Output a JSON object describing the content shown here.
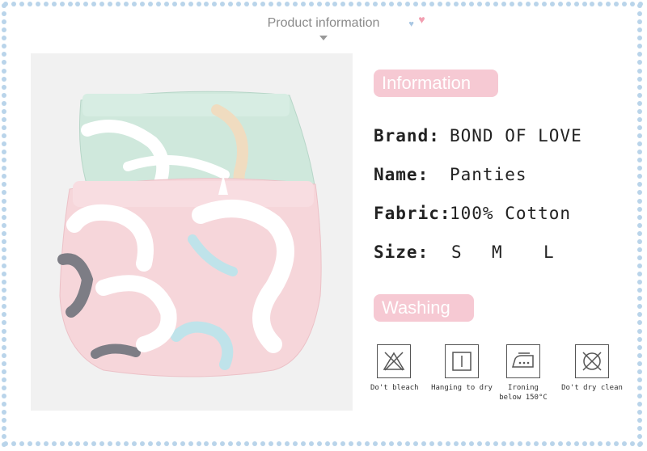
{
  "header": {
    "title": "Product information"
  },
  "info_section": {
    "heading": "Information",
    "brand_label": "Brand:",
    "brand_value": "BOND OF LOVE",
    "name_label": "Name:",
    "name_value": "Panties",
    "fabric_label": "Fabric:",
    "fabric_value": "100% Cotton",
    "size_label": "Size:",
    "sizes": [
      "S",
      "M",
      "L"
    ]
  },
  "washing_section": {
    "heading": "Washing",
    "items": [
      {
        "icon": "no-bleach-icon",
        "caption": "Do't bleach"
      },
      {
        "icon": "hang-dry-icon",
        "caption": "Hanging to dry"
      },
      {
        "icon": "iron-icon",
        "caption": "Ironing",
        "caption2": "below 150°C"
      },
      {
        "icon": "no-dry-clean-icon",
        "caption": "Do't dry clean"
      }
    ]
  },
  "colors": {
    "pill": "#f6c9d3",
    "border_dots": "#b9d4ea",
    "mint": "#cfe8dc",
    "pink": "#f6d6da"
  }
}
